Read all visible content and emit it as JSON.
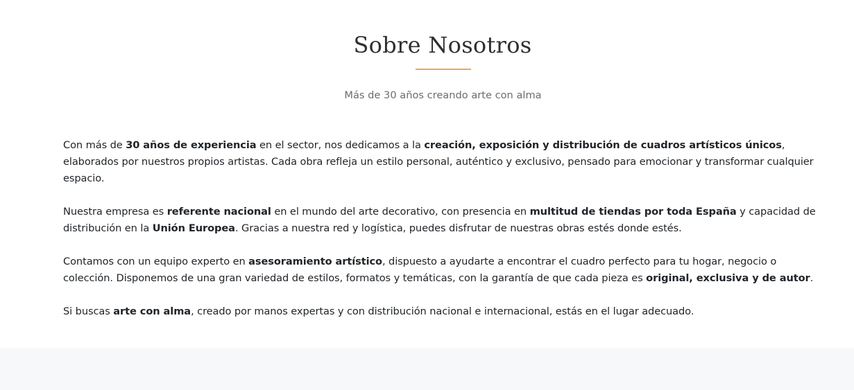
{
  "about": {
    "title": "Sobre Nosotros",
    "subtitle": "Más de 30 años creando arte con alma",
    "accent_color": "#e8a65b",
    "paragraphs": [
      {
        "parts": [
          {
            "text": "Con más de ",
            "bold": false
          },
          {
            "text": "30 años de experiencia",
            "bold": true
          },
          {
            "text": " en el sector, nos dedicamos a la ",
            "bold": false
          },
          {
            "text": "creación, exposición y distribución de cuadros artísticos únicos",
            "bold": true
          },
          {
            "text": ", elaborados por nuestros propios artistas. Cada obra refleja un estilo personal, auténtico y exclusivo, pensado para emocionar y transformar cualquier espacio.",
            "bold": false
          }
        ]
      },
      {
        "parts": [
          {
            "text": "Nuestra empresa es ",
            "bold": false
          },
          {
            "text": "referente nacional",
            "bold": true
          },
          {
            "text": " en el mundo del arte decorativo, con presencia en ",
            "bold": false
          },
          {
            "text": "multitud de tiendas por toda España",
            "bold": true
          },
          {
            "text": " y capacidad de distribución en la ",
            "bold": false
          },
          {
            "text": "Unión Europea",
            "bold": true
          },
          {
            "text": ". Gracias a nuestra red y logística, puedes disfrutar de nuestras obras estés donde estés.",
            "bold": false
          }
        ]
      },
      {
        "parts": [
          {
            "text": "Contamos con un equipo experto en ",
            "bold": false
          },
          {
            "text": "asesoramiento artístico",
            "bold": true
          },
          {
            "text": ", dispuesto a ayudarte a encontrar el cuadro perfecto para tu hogar, negocio o colección. Disponemos de una gran variedad de estilos, formatos y temáticas, con la garantía de que cada pieza es ",
            "bold": false
          },
          {
            "text": "original, exclusiva y de autor",
            "bold": true
          },
          {
            "text": ".",
            "bold": false
          }
        ]
      },
      {
        "parts": [
          {
            "text": "Si buscas ",
            "bold": false
          },
          {
            "text": "arte con alma",
            "bold": true
          },
          {
            "text": ", creado por manos expertas y con distribución nacional e internacional, estás en el lugar adecuado.",
            "bold": false
          }
        ]
      }
    ]
  }
}
